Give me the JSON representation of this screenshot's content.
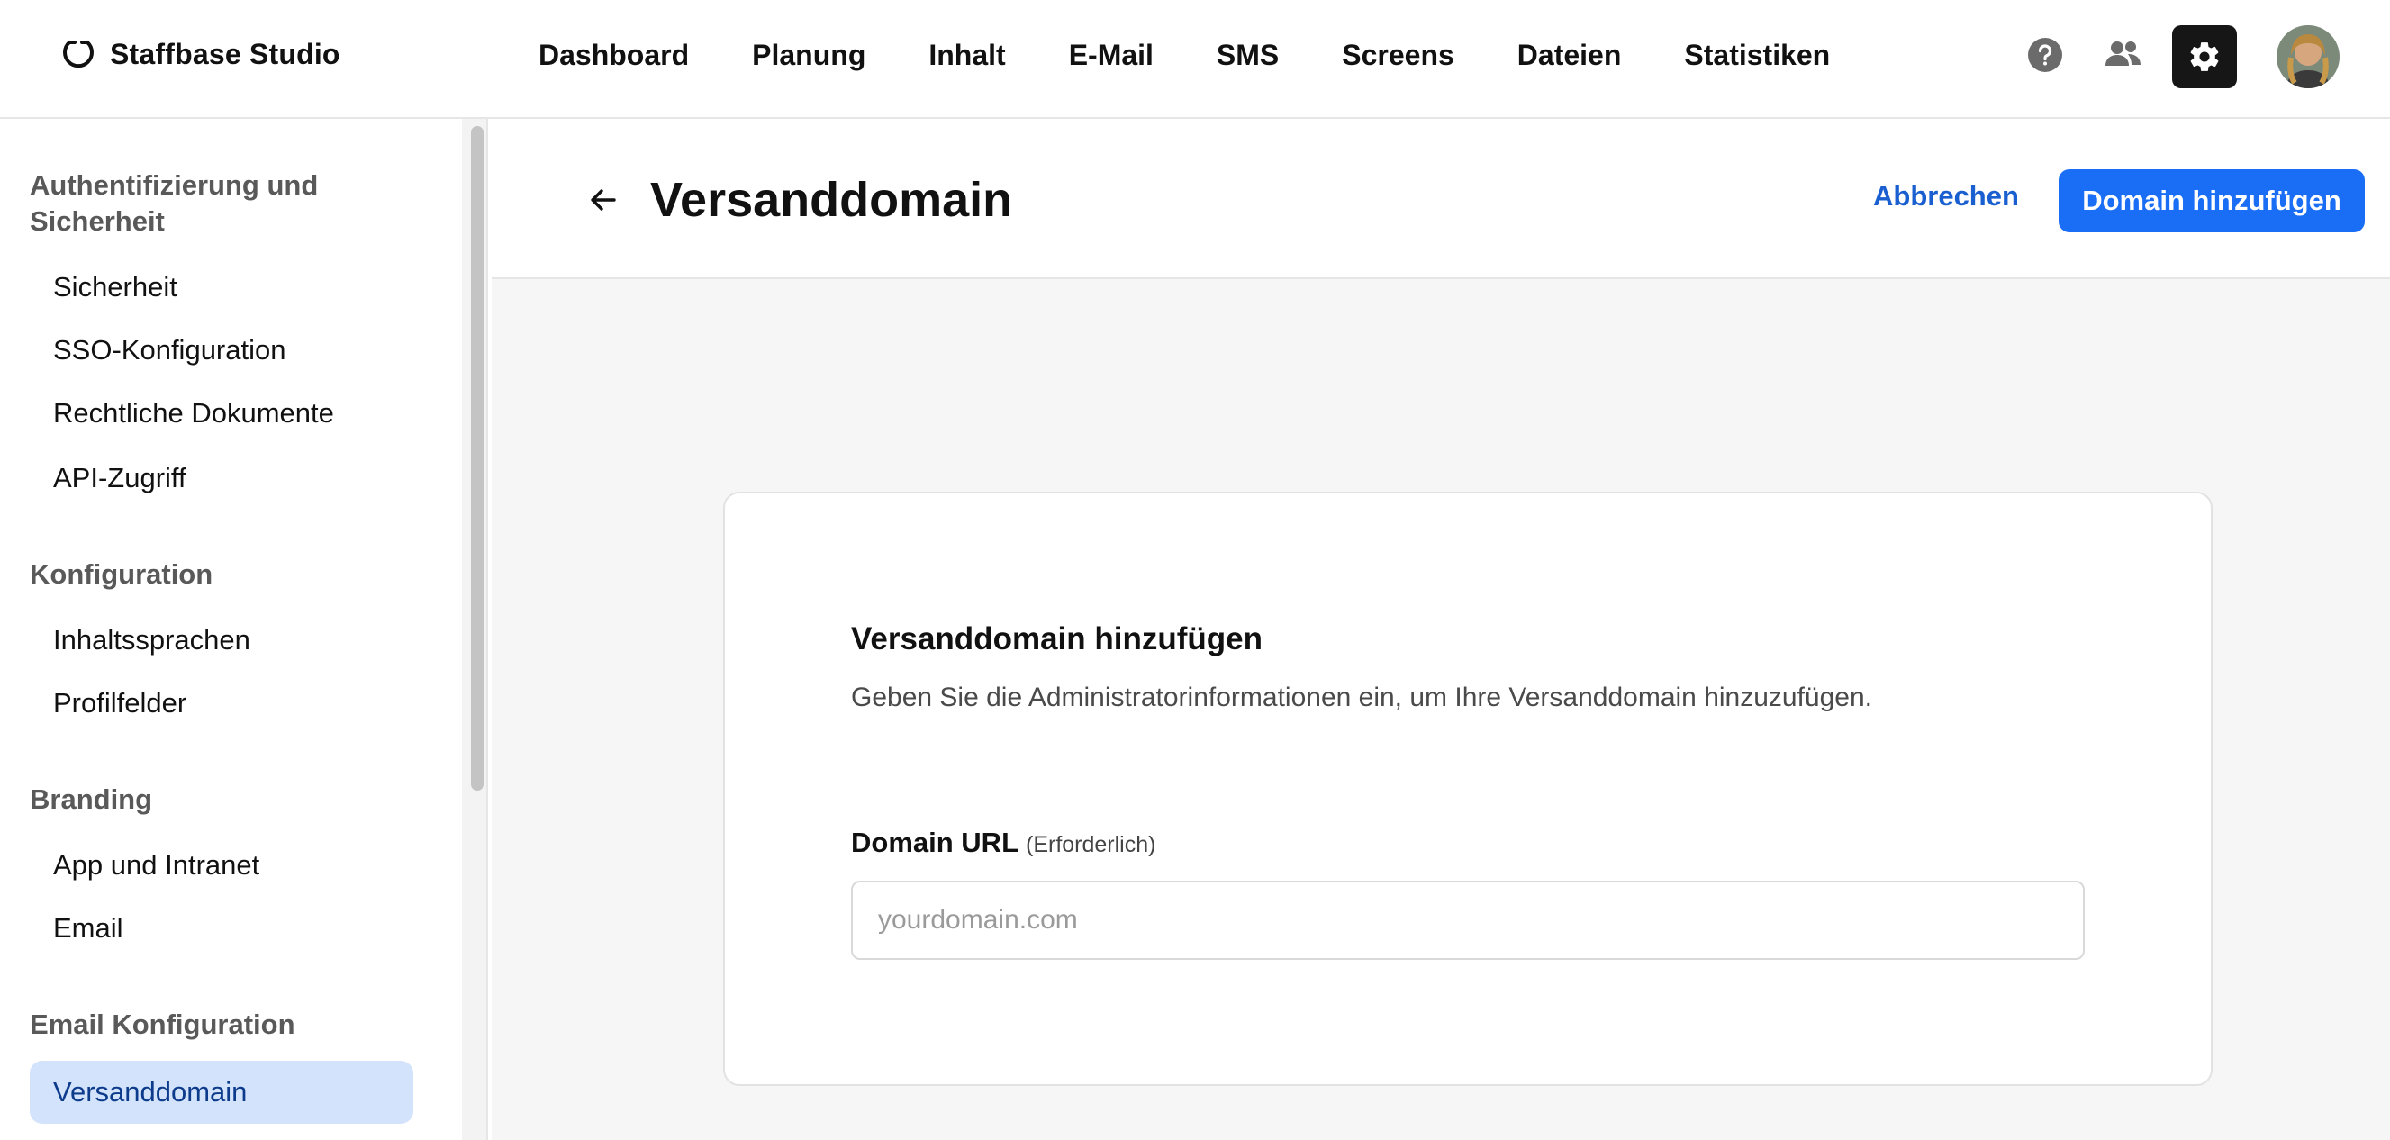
{
  "app": {
    "name": "Staffbase Studio"
  },
  "nav": {
    "items": [
      "Dashboard",
      "Planung",
      "Inhalt",
      "E-Mail",
      "SMS",
      "Screens",
      "Dateien",
      "Statistiken"
    ]
  },
  "top_icons": [
    "help-icon",
    "users-icon",
    "gear-icon",
    "avatar"
  ],
  "sidebar": {
    "groups": [
      {
        "title": "Authentifizierung und Sicherheit",
        "items": [
          "Sicherheit",
          "SSO-Konfiguration",
          "Rechtliche Dokumente",
          "API-Zugriff"
        ]
      },
      {
        "title": "Konfiguration",
        "items": [
          "Inhaltssprachen",
          "Profilfelder"
        ]
      },
      {
        "title": "Branding",
        "items": [
          "App und Intranet",
          "Email"
        ]
      },
      {
        "title": "Email Konfiguration",
        "items": [
          "Versanddomain"
        ]
      }
    ],
    "active_item": "Versanddomain"
  },
  "header": {
    "title": "Versanddomain",
    "cancel_label": "Abbrechen",
    "primary_label": "Domain hinzufügen"
  },
  "card": {
    "title": "Versanddomain hinzufügen",
    "description": "Geben Sie die Administratorinformationen ein, um Ihre Versanddomain hinzuzufügen.",
    "field": {
      "label": "Domain URL",
      "required_note": "(Erforderlich)",
      "value": "",
      "placeholder": "yourdomain.com"
    }
  },
  "colors": {
    "primary": "#1a6ef5",
    "link": "#1a5fd0",
    "active_bg": "#d2e3fb",
    "settings_bg": "#161616"
  }
}
